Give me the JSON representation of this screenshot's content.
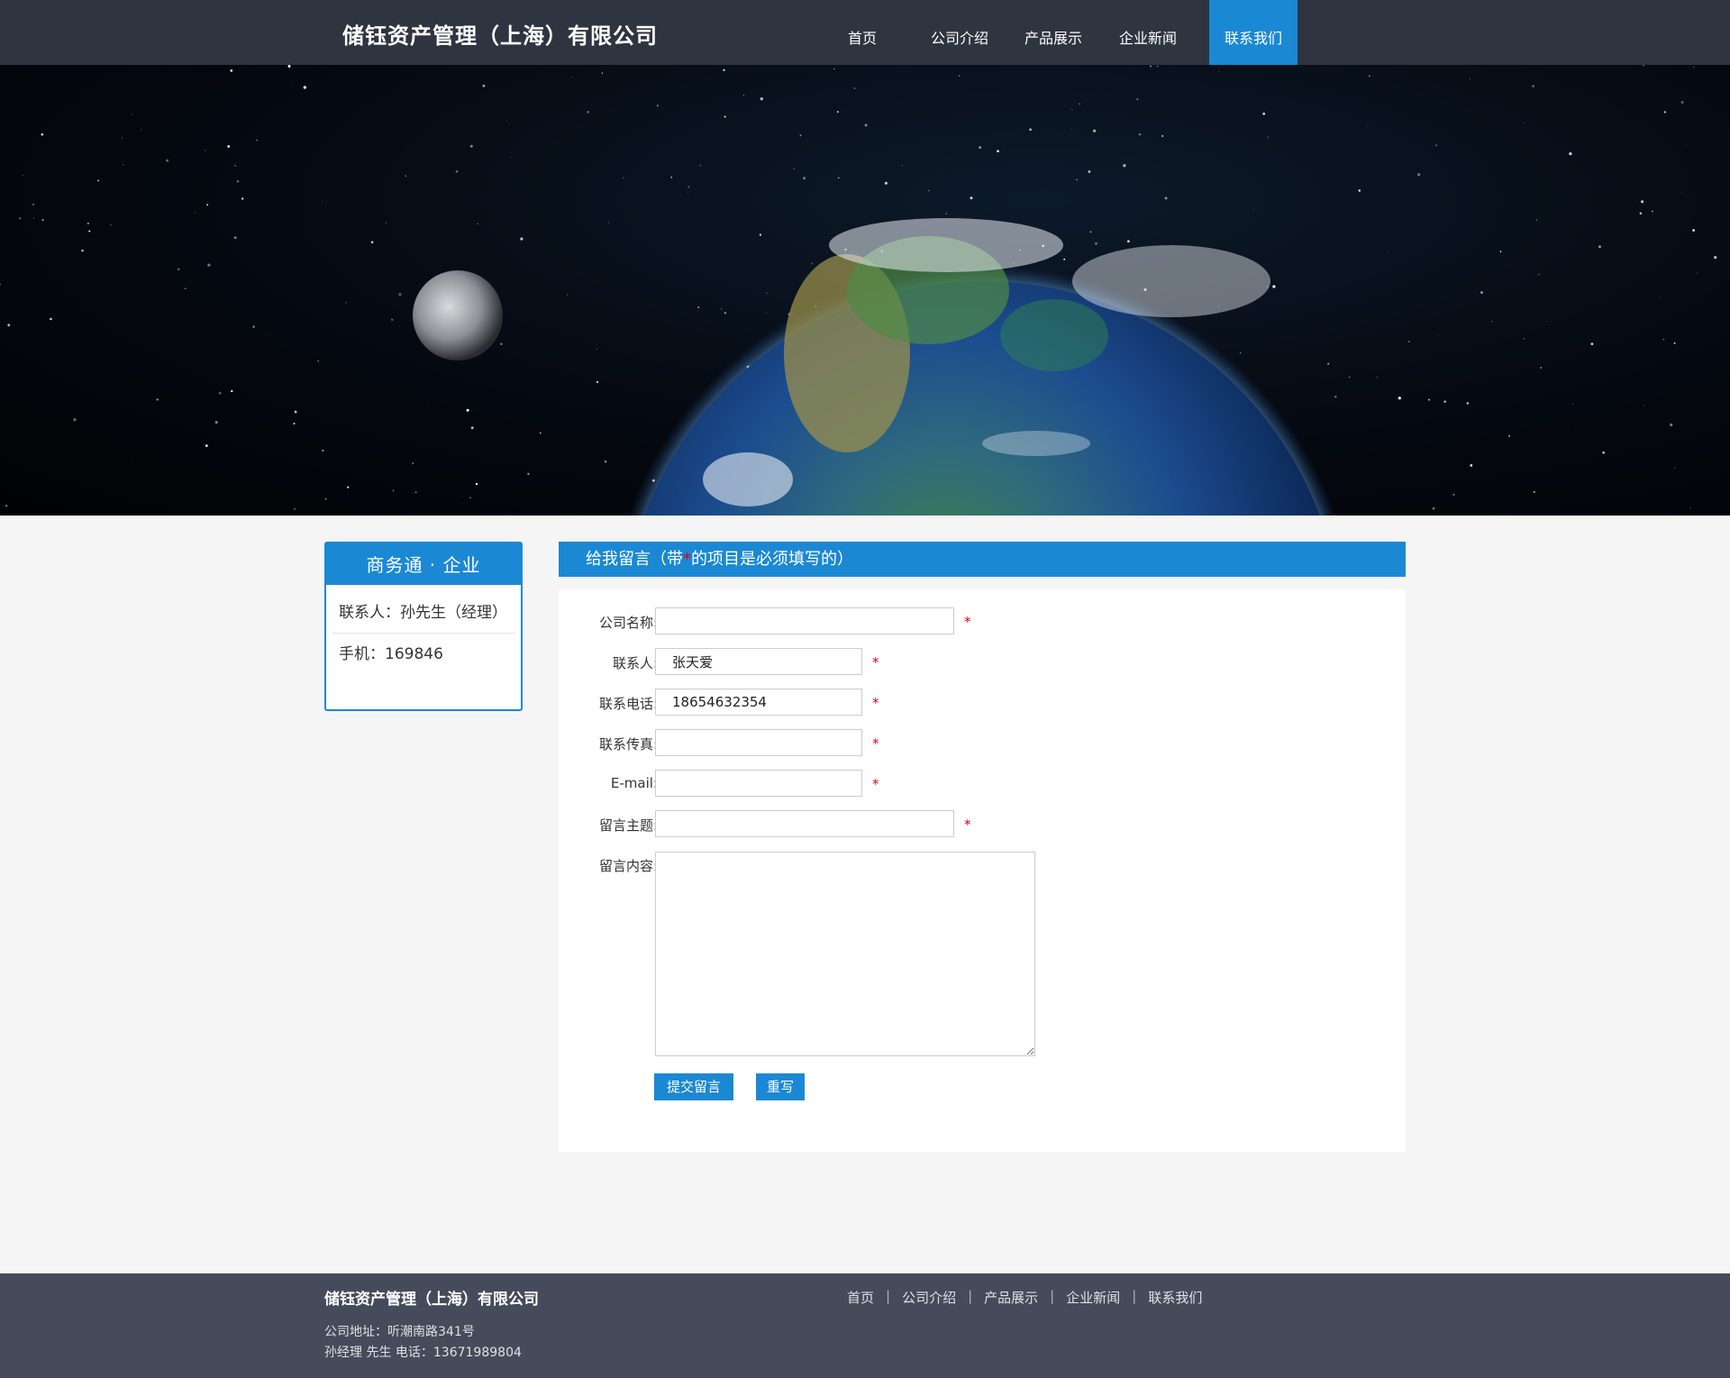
{
  "header": {
    "site_title": "储钰资产管理（上海）有限公司",
    "nav": [
      {
        "label": "首页",
        "active": false
      },
      {
        "label": "公司介绍",
        "active": false
      },
      {
        "label": "产品展示",
        "active": false
      },
      {
        "label": "企业新闻",
        "active": false
      },
      {
        "label": "联系我们",
        "active": true
      }
    ]
  },
  "sidebar": {
    "title": "商务通 · 企业",
    "contact": "联系人：孙先生（经理）",
    "mobile": "手机：169846"
  },
  "form": {
    "heading_pre": "给我留言（带",
    "heading_star": "*",
    "heading_post": "的项目是必须填写的）",
    "fields": {
      "company": {
        "label": "公司名称:",
        "value": ""
      },
      "contact": {
        "label": "联系人:",
        "value": "张天爱"
      },
      "phone": {
        "label": "联系电话:",
        "value": "18654632354"
      },
      "fax": {
        "label": "联系传真:",
        "value": ""
      },
      "email": {
        "label": "E-mail:",
        "value": ""
      },
      "subject": {
        "label": "留言主题:",
        "value": ""
      },
      "content": {
        "label": "留言内容:",
        "value": ""
      }
    },
    "required_mark": "*",
    "submit_label": "提交留言",
    "reset_label": "重写"
  },
  "footer": {
    "company": "储钰资产管理（上海）有限公司",
    "address": "公司地址：听潮南路341号",
    "contact": "孙经理  先生    电话：13671989804",
    "nav": [
      "首页",
      "公司介绍",
      "产品展示",
      "企业新闻",
      "联系我们"
    ],
    "separator": "|"
  },
  "colors": {
    "header_bg": "#2f3441",
    "accent": "#1b88d4",
    "footer_bg": "#454b5a",
    "required": "#e60012"
  }
}
